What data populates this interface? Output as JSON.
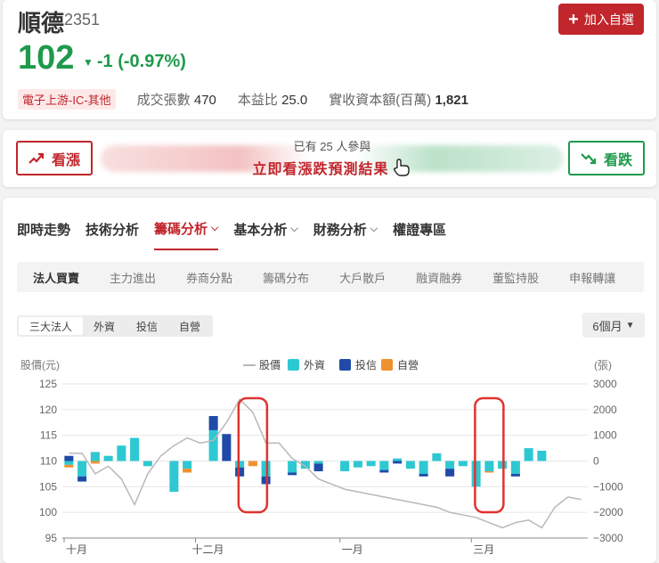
{
  "stock": {
    "name": "順德",
    "code": "2351",
    "price": "102",
    "change": "-1 (-0.97%)",
    "change_icon": "triangle-down",
    "industry": "電子上游-IC-其他",
    "volume_label": "成交張數",
    "volume": "470",
    "pe_label": "本益比",
    "pe": "25.0",
    "capital_label": "實收資本額(百萬)",
    "capital": "1,821"
  },
  "watchlist": {
    "label": "加入自選"
  },
  "vote": {
    "up_label": "看漲",
    "down_label": "看跌",
    "count_text": "已有 25 人參與",
    "cta": "立即看漲跌預測結果"
  },
  "tabs": [
    {
      "label": "即時走勢",
      "has_menu": false
    },
    {
      "label": "技術分析",
      "has_menu": false
    },
    {
      "label": "籌碼分析",
      "has_menu": true
    },
    {
      "label": "基本分析",
      "has_menu": true
    },
    {
      "label": "財務分析",
      "has_menu": true
    },
    {
      "label": "權證專區",
      "has_menu": false
    }
  ],
  "active_tab": "籌碼分析",
  "subtabs": [
    "法人買賣",
    "主力進出",
    "券商分點",
    "籌碼分布",
    "大戶散戶",
    "融資融券",
    "董監持股",
    "申報轉讓"
  ],
  "active_subtab": "法人買賣",
  "investor_filter": [
    "三大法人",
    "外資",
    "投信",
    "自營"
  ],
  "active_filter": "三大法人",
  "period": {
    "value": "6個月"
  },
  "colors": {
    "red": "#c0262c",
    "green": "#1e9a4b",
    "foreign": "#2ec8d2",
    "trust": "#1f4aa8",
    "dealer": "#f0912f",
    "price_line": "#b8b8b8",
    "highlight": "#e0332f"
  },
  "chart_data": {
    "type": "bar",
    "ylabel": "股價(元)",
    "ylabel_right": "(張)",
    "legend": [
      "股價",
      "外資",
      "投信",
      "自營"
    ],
    "y_ticks_left": [
      "125",
      "120",
      "115",
      "110",
      "105",
      "100",
      "95"
    ],
    "y_ticks_right": [
      "3000",
      "2000",
      "1000",
      "0",
      "−1000",
      "−2000",
      "−3000"
    ],
    "ylim_left": [
      95,
      125
    ],
    "ylim_right": [
      -3000,
      3000
    ],
    "x_ticks": [
      "十月",
      "十二月",
      "一月",
      "三月"
    ],
    "x_tick_index": [
      0,
      10,
      21,
      31
    ],
    "highlighted_index": [
      14,
      32
    ],
    "price": [
      111.5,
      111.5,
      107.5,
      109,
      106.5,
      101.5,
      107.5,
      111,
      113,
      114.5,
      113.5,
      114,
      117.5,
      122,
      119.5,
      113.5,
      113.5,
      110.5,
      109,
      106.5,
      105.5,
      104.5,
      104,
      103.5,
      103,
      102.5,
      102,
      101.5,
      101,
      100,
      99.5,
      99,
      98,
      97,
      98,
      98.5,
      97,
      101,
      103,
      102.5
    ],
    "foreign": [
      -150,
      -600,
      350,
      200,
      600,
      900,
      -200,
      0,
      -1200,
      -300,
      0,
      1200,
      0,
      -250,
      0,
      -600,
      0,
      -450,
      -300,
      -100,
      0,
      -400,
      -250,
      -200,
      -350,
      100,
      -300,
      -500,
      300,
      -300,
      -200,
      -1000,
      -400,
      -300,
      -500,
      500,
      400,
      0,
      0,
      0
    ],
    "trust": [
      200,
      -200,
      0,
      0,
      0,
      0,
      0,
      0,
      0,
      0,
      0,
      550,
      1050,
      -350,
      0,
      -300,
      0,
      -100,
      0,
      -300,
      0,
      0,
      0,
      0,
      -100,
      -100,
      0,
      -100,
      0,
      -300,
      0,
      0,
      0,
      0,
      -100,
      0,
      0,
      0,
      0,
      0
    ],
    "dealer": [
      -100,
      0,
      -100,
      0,
      0,
      0,
      0,
      0,
      0,
      -150,
      0,
      0,
      0,
      0,
      -200,
      0,
      0,
      0,
      0,
      0,
      0,
      0,
      0,
      0,
      0,
      0,
      0,
      0,
      0,
      0,
      0,
      0,
      -50,
      0,
      0,
      0,
      0,
      0,
      0,
      0
    ]
  }
}
